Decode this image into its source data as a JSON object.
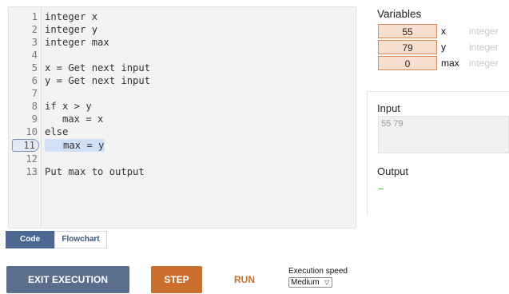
{
  "editor": {
    "lines": [
      {
        "n": "1",
        "text": "integer x"
      },
      {
        "n": "2",
        "text": "integer y"
      },
      {
        "n": "3",
        "text": "integer max"
      },
      {
        "n": "4",
        "text": ""
      },
      {
        "n": "5",
        "text": "x = Get next input"
      },
      {
        "n": "6",
        "text": "y = Get next input"
      },
      {
        "n": "7",
        "text": ""
      },
      {
        "n": "8",
        "text": "if x > y"
      },
      {
        "n": "9",
        "text": "   max = x"
      },
      {
        "n": "10",
        "text": "else"
      },
      {
        "n": "11",
        "text": "   max = y"
      },
      {
        "n": "12",
        "text": ""
      },
      {
        "n": "13",
        "text": "Put max to output"
      }
    ],
    "current_line": "11"
  },
  "tabs": {
    "code": "Code",
    "flowchart": "Flowchart",
    "active": "Code"
  },
  "variables": {
    "title": "Variables",
    "rows": [
      {
        "value": "55",
        "name": "x",
        "type": "integer"
      },
      {
        "value": "79",
        "name": "y",
        "type": "integer"
      },
      {
        "value": "0",
        "name": "max",
        "type": "integer"
      }
    ]
  },
  "io": {
    "input_label": "Input",
    "input_value": "55 79",
    "output_label": "Output",
    "output_value": ""
  },
  "controls": {
    "exit": "EXIT EXECUTION",
    "step": "STEP",
    "run": "RUN",
    "speed_label": "Execution speed",
    "speed_value": "Medium",
    "chevron": "▽"
  },
  "colors": {
    "exit_button": "#5a6d8c",
    "step_button": "#cc6e2e",
    "run_text": "#cc6e2e",
    "var_fill": "#f7dfcf",
    "var_border": "#d88a55",
    "active_tab": "#4a6891",
    "current_line_highlight": "#cfe0f7"
  }
}
